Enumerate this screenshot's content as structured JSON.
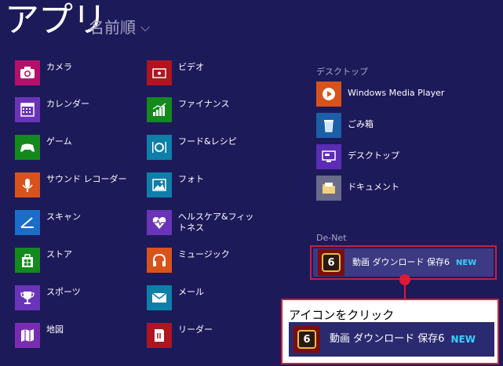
{
  "header": {
    "title": "アプリ",
    "sort_label": "名前順",
    "sort_chevron": "⌵"
  },
  "column1": [
    {
      "label": "カメラ",
      "color": "#b4106a"
    },
    {
      "label": "カレンダー",
      "color": "#6a34b8"
    },
    {
      "label": "ゲーム",
      "color": "#138a1b"
    },
    {
      "label": "サウンド レコーダー",
      "color": "#d7531b"
    },
    {
      "label": "スキャン",
      "color": "#1a6ec8"
    },
    {
      "label": "ストア",
      "color": "#138a1b"
    },
    {
      "label": "スポーツ",
      "color": "#6a34b8"
    },
    {
      "label": "地図",
      "color": "#7a2cb0"
    }
  ],
  "column2": [
    {
      "label": "ビデオ",
      "color": "#b0141e"
    },
    {
      "label": "ファイナンス",
      "color": "#138a1b"
    },
    {
      "label": "フード&レシピ",
      "color": "#0d7fa8"
    },
    {
      "label": "フォト",
      "color": "#0d7fa8"
    },
    {
      "label": "ヘルスケア&フィットネス",
      "color": "#6a34b8"
    },
    {
      "label": "ミュージック",
      "color": "#d7531b"
    },
    {
      "label": "メール",
      "color": "#0d7fa8"
    },
    {
      "label": "リーダー",
      "color": "#b0141e"
    }
  ],
  "desktop_group": {
    "title": "デスクトップ",
    "items": [
      {
        "label": "Windows Media Player",
        "color": "#d7531b"
      },
      {
        "label": "ごみ箱",
        "color": "#1a5fa8"
      },
      {
        "label": "デスクトップ",
        "color": "#5b2cb5"
      },
      {
        "label": "ドキュメント",
        "color": "#6a6a8a"
      }
    ]
  },
  "denet_group": {
    "title": "De-Net",
    "app_label": "動画 ダウンロード 保存6",
    "badge": "NEW",
    "tile_number": "6"
  },
  "callout": {
    "text": "アイコンをクリック",
    "app_label": "動画 ダウンロード 保存6",
    "badge": "NEW",
    "tile_number": "6"
  }
}
